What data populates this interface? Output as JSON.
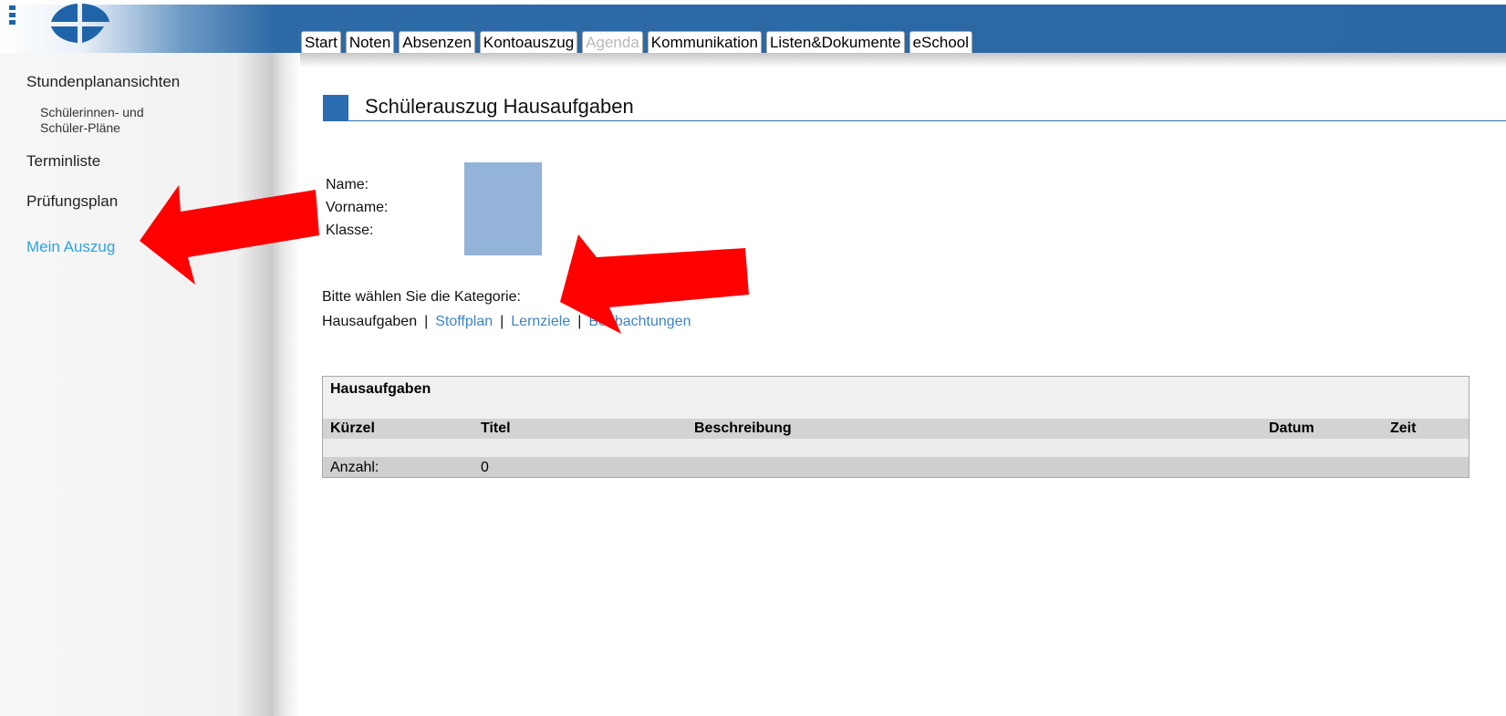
{
  "nav": {
    "tabs": [
      {
        "label": "Start",
        "enabled": true
      },
      {
        "label": "Noten",
        "enabled": true
      },
      {
        "label": "Absenzen",
        "enabled": true
      },
      {
        "label": "Kontoauszug",
        "enabled": true
      },
      {
        "label": "Agenda",
        "enabled": false
      },
      {
        "label": "Kommunikation",
        "enabled": true
      },
      {
        "label": "Listen&Dokumente",
        "enabled": true
      },
      {
        "label": "eSchool",
        "enabled": true
      }
    ]
  },
  "sidebar": {
    "items": [
      {
        "label": "Stundenplanansichten"
      },
      {
        "label": "Schülerinnen- und"
      },
      {
        "label": "Schüler-Pläne"
      },
      {
        "label": "Terminliste"
      },
      {
        "label": "Prüfungsplan"
      },
      {
        "label": "Mein Auszug",
        "active": true
      }
    ]
  },
  "page": {
    "title": "Schülerauszug Hausaufgaben"
  },
  "student": {
    "name_label": "Name:",
    "vorname_label": "Vorname:",
    "klasse_label": "Klasse:"
  },
  "category": {
    "prompt": "Bitte wählen Sie die Kategorie:",
    "options": [
      "Hausaufgaben",
      "Stoffplan",
      "Lernziele",
      "Beobachtungen"
    ],
    "separator": "|",
    "selected": "Hausaufgaben"
  },
  "table": {
    "title": "Hausaufgaben",
    "columns": [
      "Kürzel",
      "Titel",
      "Beschreibung",
      "Datum",
      "Zeit"
    ],
    "footer_label": "Anzahl:",
    "footer_value": "0"
  },
  "colors": {
    "header_blue": "#2b67a3",
    "link_blue": "#3d84c6",
    "active_sidebar": "#2ea3e3",
    "annotation_red": "#ff0000"
  }
}
